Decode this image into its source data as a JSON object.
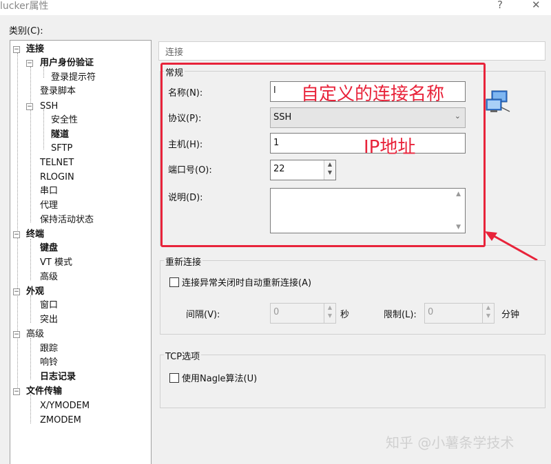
{
  "window": {
    "title": "lucker属性",
    "help_label": "?",
    "close_label": "✕"
  },
  "category_label": "类别(C):",
  "tree": [
    {
      "label": "连接",
      "bold": true
    },
    {
      "label": "用户身份验证",
      "bold": true
    },
    {
      "label": "登录提示符",
      "bold": false
    },
    {
      "label": "登录脚本",
      "bold": false
    },
    {
      "label": "SSH",
      "bold": false
    },
    {
      "label": "安全性",
      "bold": false
    },
    {
      "label": "隧道",
      "bold": true
    },
    {
      "label": "SFTP",
      "bold": false
    },
    {
      "label": "TELNET",
      "bold": false
    },
    {
      "label": "RLOGIN",
      "bold": false
    },
    {
      "label": "串口",
      "bold": false
    },
    {
      "label": "代理",
      "bold": false
    },
    {
      "label": "保持活动状态",
      "bold": false
    },
    {
      "label": "终端",
      "bold": true
    },
    {
      "label": "键盘",
      "bold": true
    },
    {
      "label": "VT 模式",
      "bold": false
    },
    {
      "label": "高级",
      "bold": false
    },
    {
      "label": "外观",
      "bold": true
    },
    {
      "label": "窗口",
      "bold": false
    },
    {
      "label": "突出",
      "bold": false
    },
    {
      "label": "高级",
      "bold": false
    },
    {
      "label": "跟踪",
      "bold": false
    },
    {
      "label": "响铃",
      "bold": false
    },
    {
      "label": "日志记录",
      "bold": true
    },
    {
      "label": "文件传输",
      "bold": true
    },
    {
      "label": "X/YMODEM",
      "bold": false
    },
    {
      "label": "ZMODEM",
      "bold": false
    }
  ],
  "panel_header": "连接",
  "general": {
    "group_title": "常规",
    "name_label": "名称(N):",
    "name_value": "l",
    "protocol_label": "协议(P):",
    "protocol_value": "SSH",
    "host_label": "主机(H):",
    "host_value": "1",
    "port_label": "端口号(O):",
    "port_value": "22",
    "desc_label": "说明(D):",
    "desc_value": ""
  },
  "reconnect": {
    "group_title": "重新连接",
    "checkbox_label": "连接异常关闭时自动重新连接(A)",
    "interval_label": "间隔(V):",
    "interval_value": "0",
    "interval_unit": "秒",
    "limit_label": "限制(L):",
    "limit_value": "0",
    "limit_unit": "分钟"
  },
  "tcp": {
    "group_title": "TCP选项",
    "nagle_label": "使用Nagle算法(U)"
  },
  "annotations": {
    "name_note": "自定义的连接名称",
    "ip_note": "IP地址",
    "color": "#e8233a"
  },
  "watermark": "知乎 @小薯条学技术"
}
